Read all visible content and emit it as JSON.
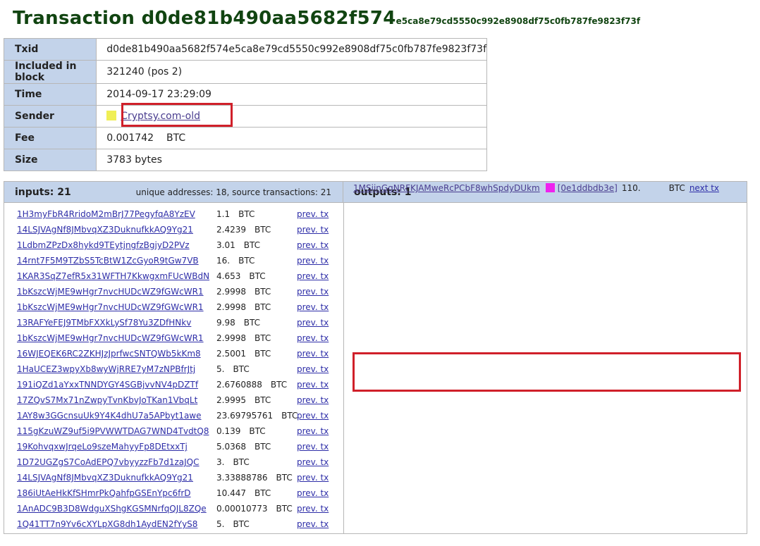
{
  "page": {
    "title_prefix": "Transaction ",
    "title_hash_big": "d0de81b490aa5682f574",
    "title_hash_small": "e5ca8e79cd5550c992e8908df75c0fb787fe9823f73f"
  },
  "info": {
    "txid_label": "Txid",
    "txid": "d0de81b490aa5682f574e5ca8e79cd5550c992e8908df75c0fb787fe9823f73f",
    "block_label": "Included in block",
    "block": "321240 (pos 2)",
    "time_label": "Time",
    "time": "2014-09-17 23:29:09",
    "sender_label": "Sender",
    "sender": "Cryptsy.com-old",
    "sender_color": "#f0ef55",
    "fee_label": "Fee",
    "fee": "0.001742",
    "fee_unit": "BTC",
    "size_label": "Size",
    "size": "3783 bytes"
  },
  "inputs": {
    "header": "inputs: 21",
    "meta": "unique addresses: 18, source transactions: 21",
    "rows": [
      {
        "addr": "1H3myFbR4RridoM2mBrJ77PegyfqA8YzEV",
        "amount": "1.1",
        "unit": "BTC",
        "link": "prev. tx"
      },
      {
        "addr": "14LSJVAgNf8JMbvqXZ3DuknufkkAQ9Yg21",
        "amount": "2.4239",
        "unit": "BTC",
        "link": "prev. tx"
      },
      {
        "addr": "1LdbmZPzDx8hykd9TEytjngfzBgjyD2PVz",
        "amount": "3.01",
        "unit": "BTC",
        "link": "prev. tx"
      },
      {
        "addr": "14rnt7F5M9TZbS5TcBtW1ZcGyoR9tGw7VB",
        "amount": "16.",
        "unit": "BTC",
        "link": "prev. tx"
      },
      {
        "addr": "1KAR3SqZ7efR5x31WFTH7KkwgxmFUcWBdN",
        "amount": "4.653",
        "unit": "BTC",
        "link": "prev. tx"
      },
      {
        "addr": "1bKszcWjME9wHgr7nvcHUDcWZ9fGWcWR1",
        "amount": "2.9998",
        "unit": "BTC",
        "link": "prev. tx"
      },
      {
        "addr": "1bKszcWjME9wHgr7nvcHUDcWZ9fGWcWR1",
        "amount": "2.9998",
        "unit": "BTC",
        "link": "prev. tx"
      },
      {
        "addr": "13RAFYeFEJ9TMbFXXkLySf78Yu3ZDfHNkv",
        "amount": "9.98",
        "unit": "BTC",
        "link": "prev. tx"
      },
      {
        "addr": "1bKszcWjME9wHgr7nvcHUDcWZ9fGWcWR1",
        "amount": "2.9998",
        "unit": "BTC",
        "link": "prev. tx"
      },
      {
        "addr": "16WJEQEK6RC2ZKHJzJprfwcSNTQWb5kKm8",
        "amount": "2.5001",
        "unit": "BTC",
        "link": "prev. tx"
      },
      {
        "addr": "1HaUCEZ3wpyXb8wyWjRRE7yM7zNPBfrJtj",
        "amount": "5.",
        "unit": "BTC",
        "link": "prev. tx"
      },
      {
        "addr": "191iQZd1aYxxTNNDYGY4SGBjvvNV4pDZTf",
        "amount": "2.6760888",
        "unit": "BTC",
        "link": "prev. tx"
      },
      {
        "addr": "17ZQvS7Mx71nZwpyTvnKbvJoTKan1VbqLt",
        "amount": "2.9995",
        "unit": "BTC",
        "link": "prev. tx"
      },
      {
        "addr": "1AY8w3GGcnsuUk9Y4K4dhU7a5APbyt1awe",
        "amount": "23.69795761",
        "unit": "BTC",
        "link": "prev. tx"
      },
      {
        "addr": "115gKzuWZ9uf5i9PVWWTDAG7WND4TvdtQ8",
        "amount": "0.139",
        "unit": "BTC",
        "link": "prev. tx"
      },
      {
        "addr": "19KohvqxwJrqeLo9szeMahyyFp8DEtxxTj",
        "amount": "5.0368",
        "unit": "BTC",
        "link": "prev. tx"
      },
      {
        "addr": "1D72UGZgS7CoAdEPQ7vbyyzzFb7d1zaJQC",
        "amount": "3.",
        "unit": "BTC",
        "link": "prev. tx"
      },
      {
        "addr": "14LSJVAgNf8JMbvqXZ3DuknufkkAQ9Yg21",
        "amount": "3.33888786",
        "unit": "BTC",
        "link": "prev. tx"
      },
      {
        "addr": "186iUtAeHkKfSHmrPkQahfpGSEnYpc6frD",
        "amount": "10.447",
        "unit": "BTC",
        "link": "prev. tx"
      },
      {
        "addr": "1AnADC9B3D8WdguXShgKGSMNrfqQJL8ZQe",
        "amount": "0.00010773",
        "unit": "BTC",
        "link": "prev. tx"
      },
      {
        "addr": "1Q41TT7n9Yv6cXYLpXG8dh1AydEN2fYyS8",
        "amount": "5.",
        "unit": "BTC",
        "link": "prev. tx"
      }
    ]
  },
  "outputs": {
    "header": "outputs: 1",
    "rows": [
      {
        "addr": "1MSijnGgNRFKJAMweRcPCbF8whSpdyDUkm",
        "color": "#ee22ee",
        "tx": "[0e1ddbdb3e]",
        "amount": "110.",
        "unit": "BTC",
        "link": "next tx"
      }
    ]
  }
}
